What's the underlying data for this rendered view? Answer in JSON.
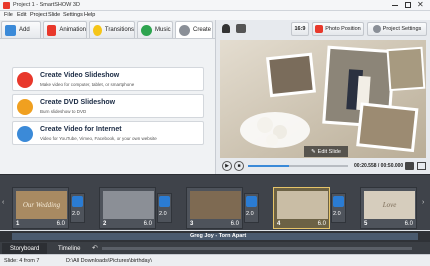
{
  "titlebar": {
    "title": "Project 1 - SmartSHOW 3D"
  },
  "menu": [
    "File",
    "Edit",
    "Project",
    "Slide",
    "Settings",
    "Help"
  ],
  "tabs": [
    {
      "label": "Add",
      "icon": "add-icon"
    },
    {
      "label": "Animation",
      "icon": "animation-icon"
    },
    {
      "label": "Transitions",
      "icon": "transitions-icon"
    },
    {
      "label": "Music",
      "icon": "music-icon"
    },
    {
      "label": "Create",
      "icon": "create-icon"
    }
  ],
  "create_options": [
    {
      "title": "Create Video Slideshow",
      "desc": "Make video for computer, tablet, or smartphone",
      "icon": "video-icon",
      "color": "#e8382b"
    },
    {
      "title": "Create DVD Slideshow",
      "desc": "Burn slideshow to DVD",
      "icon": "dvd-icon",
      "color": "#f0a020"
    },
    {
      "title": "Create Video for Internet",
      "desc": "Video for YouTube, Vimeo, Facebook, or your own website",
      "icon": "globe-icon",
      "color": "#3b8ad8"
    }
  ],
  "toolbar": {
    "aspect": "16:9",
    "photo_position": "Photo Position",
    "project_settings": "Project Settings"
  },
  "preview": {
    "edit_slide": "Edit Slide"
  },
  "playback": {
    "time": "00:20.558 / 00:50.000",
    "progress": 0.41
  },
  "slides": [
    {
      "number": "1",
      "duration": "6.0",
      "thumb_text": "Our Wedding",
      "bg": "#a88a62"
    },
    {
      "number": "2",
      "duration": "6.0",
      "thumb_text": "",
      "bg": "#8b8f96"
    },
    {
      "number": "3",
      "duration": "6.0",
      "thumb_text": "",
      "bg": "#7e6a52"
    },
    {
      "number": "4",
      "duration": "6.0",
      "thumb_text": "",
      "bg": "#c9bda5"
    },
    {
      "number": "5",
      "duration": "6.0",
      "thumb_text": "Love",
      "bg": "#d6cdbd"
    }
  ],
  "transitions": [
    "2.0",
    "2.0",
    "2.0",
    "2.0"
  ],
  "audio": {
    "track_name": "Greg Joy - Torn Apart"
  },
  "bottom_tabs": [
    "Storyboard",
    "Timeline"
  ],
  "status": {
    "slide_info": "Slide: 4 from 7",
    "path": "D:\\All Downloads\\Pictures\\birthday\\"
  }
}
